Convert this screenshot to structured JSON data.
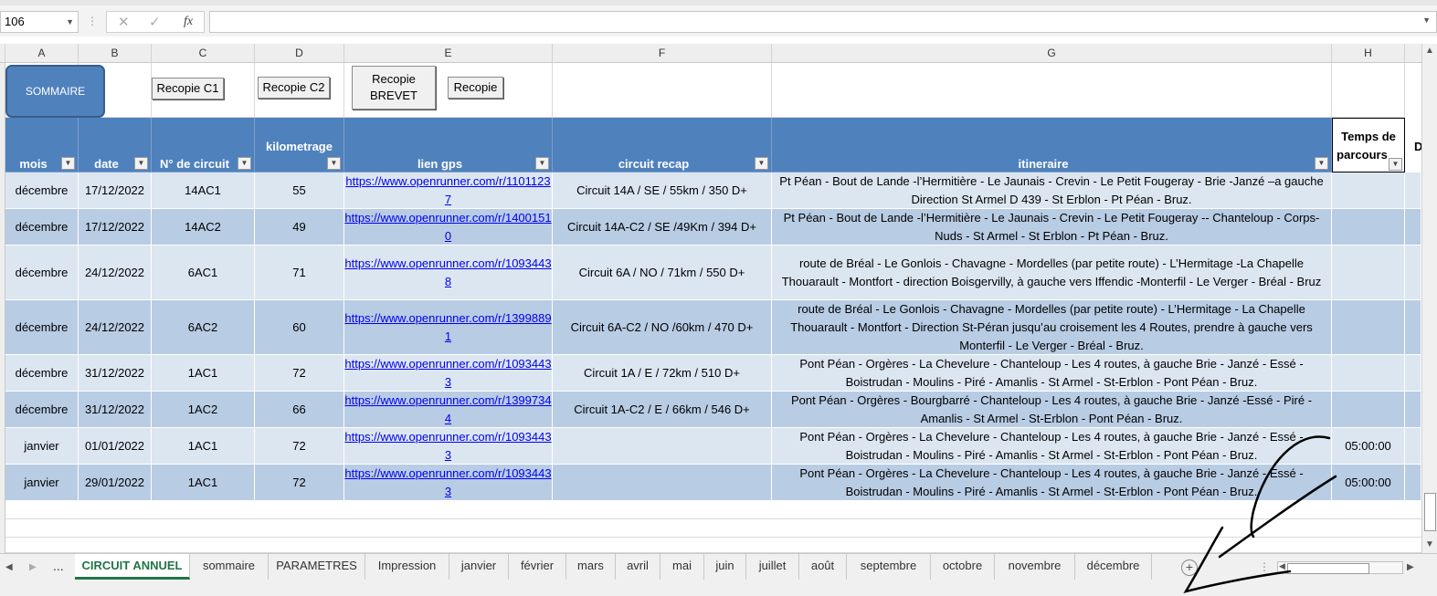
{
  "formula_bar": {
    "name_box": "106",
    "cancel_icon": "✕",
    "enter_icon": "✓",
    "fx_label": "fx",
    "formula": ""
  },
  "columns": [
    "A",
    "B",
    "C",
    "D",
    "E",
    "F",
    "G",
    "H"
  ],
  "buttons": {
    "sommaire": "SOMMAIRE",
    "recopie_c1": "Recopie C1",
    "recopie_c2": "Recopie C2",
    "recopie_brevet_line1": "Recopie",
    "recopie_brevet_line2": "BREVET",
    "recopie": "Recopie"
  },
  "table_headers": {
    "mois": "mois",
    "date": "date",
    "circuit": "N° de circuit",
    "km": "kilometrage",
    "gps": "lien gps",
    "recap": "circuit recap",
    "itineraire": "itineraire",
    "temps_line1": "Temps de",
    "temps_line2": "parcours"
  },
  "rows": [
    {
      "mois": "décembre",
      "date": "17/12/2022",
      "circuit": "14AC1",
      "km": "55",
      "gps": "https://www.openrunner.com/r/11011237",
      "recap": "Circuit 14A / SE / 55km / 350 D+",
      "itineraire": "Pt Péan - Bout de Lande -l’Hermitière - Le Jaunais - Crevin - Le Petit Fougeray - Brie -Janzé –a gauche Direction St Armel D 439 - St Erblon - Pt Péan - Bruz.",
      "temps": ""
    },
    {
      "mois": "décembre",
      "date": "17/12/2022",
      "circuit": "14AC2",
      "km": "49",
      "gps": "https://www.openrunner.com/r/14001510",
      "recap": "Circuit 14A-C2 / SE /49Km / 394 D+",
      "itineraire": "Pt Péan - Bout de Lande -l’Hermitière - Le Jaunais - Crevin - Le Petit Fougeray -- Chanteloup - Corps-Nuds - St Armel - St Erblon - Pt Péan - Bruz.",
      "temps": ""
    },
    {
      "mois": "décembre",
      "date": "24/12/2022",
      "circuit": "6AC1",
      "km": "71",
      "gps": "https://www.openrunner.com/r/10934438",
      "recap": "Circuit 6A / NO / 71km / 550 D+",
      "itineraire": "route de Bréal - Le Gonlois - Chavagne - Mordelles (par petite route) - L’Hermitage -La Chapelle Thouarault - Montfort - direction Boisgervilly, à gauche vers Iffendic -Monterfil - Le Verger - Bréal - Bruz",
      "temps": ""
    },
    {
      "mois": "décembre",
      "date": "24/12/2022",
      "circuit": "6AC2",
      "km": "60",
      "gps": "https://www.openrunner.com/r/13998891",
      "recap": "Circuit 6A-C2 / NO /60km / 470 D+",
      "itineraire": "route de Bréal - Le Gonlois - Chavagne - Mordelles (par petite route) - L’Hermitage - La Chapelle Thouarault - Montfort - Direction St-Péran jusqu’au croisement les 4 Routes, prendre à gauche vers Monterfil - Le Verger - Bréal - Bruz.",
      "temps": ""
    },
    {
      "mois": "décembre",
      "date": "31/12/2022",
      "circuit": "1AC1",
      "km": "72",
      "gps": "https://www.openrunner.com/r/10934433",
      "recap": "Circuit 1A / E / 72km / 510 D+",
      "itineraire": "Pont Péan - Orgères - La Chevelure - Chanteloup - Les 4 routes, à gauche Brie - Janzé - Essé - Boistrudan - Moulins - Piré - Amanlis - St Armel - St-Erblon - Pont Péan - Bruz.",
      "temps": ""
    },
    {
      "mois": "décembre",
      "date": "31/12/2022",
      "circuit": "1AC2",
      "km": "66",
      "gps": "https://www.openrunner.com/r/13997344",
      "recap": "Circuit 1A-C2 / E / 66km / 546 D+",
      "itineraire": "Pont Péan - Orgères - Bourgbarré - Chanteloup - Les 4 routes, à gauche Brie - Janzé -Essé - Piré - Amanlis - St Armel - St-Erblon - Pont Péan - Bruz.",
      "temps": ""
    },
    {
      "mois": "janvier",
      "date": "01/01/2022",
      "circuit": "1AC1",
      "km": "72",
      "gps": "https://www.openrunner.com/r/10934433",
      "recap": "",
      "itineraire": "Pont Péan - Orgères - La Chevelure - Chanteloup - Les 4 routes, à gauche Brie - Janzé - Essé - Boistrudan - Moulins - Piré - Amanlis - St Armel - St-Erblon - Pont Péan - Bruz.",
      "temps": "05:00:00"
    },
    {
      "mois": "janvier",
      "date": "29/01/2022",
      "circuit": "1AC1",
      "km": "72",
      "gps": "https://www.openrunner.com/r/10934433",
      "recap": "",
      "itineraire": "Pont Péan - Orgères - La Chevelure - Chanteloup - Les 4 routes, à gauche Brie - Janzé - Essé - Boistrudan - Moulins - Piré - Amanlis - St Armel - St-Erblon - Pont Péan - Bruz.",
      "temps": "05:00:00"
    }
  ],
  "sheet_tabs": [
    "CIRCUIT ANNUEL",
    "sommaire",
    "PARAMETRES",
    "Impression",
    "janvier",
    "février",
    "mars",
    "avril",
    "mai",
    "juin",
    "juillet",
    "août",
    "septembre",
    "octobre",
    "novembre",
    "décembre"
  ],
  "tab_nav": {
    "ellipsis": "...",
    "add_icon": "+"
  },
  "colors": {
    "header_blue": "#4f81bd",
    "row_light": "#dce6f1",
    "row_dark": "#b8cce4",
    "active_tab": "#217346",
    "annotation_ink": "#000000"
  },
  "annotation": "hand-drawn-arrow"
}
